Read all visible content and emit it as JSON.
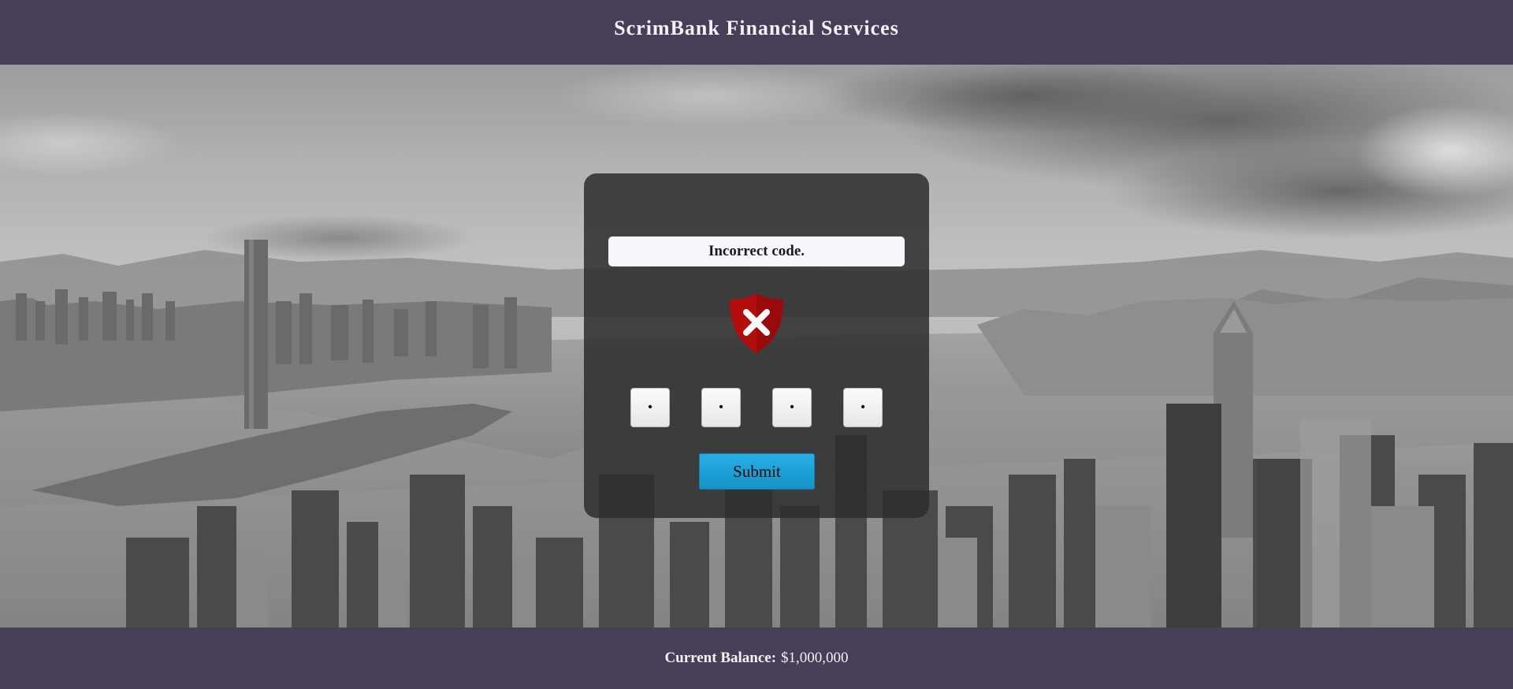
{
  "header": {
    "title": "ScrimBank Financial Services"
  },
  "dialog": {
    "error_message": "Incorrect code.",
    "status_icon": "shield-x-icon",
    "code_digits": [
      "•",
      "•",
      "•",
      "•"
    ],
    "submit_label": "Submit"
  },
  "footer": {
    "balance_label": "Current Balance:",
    "balance_value": "$1,000,000"
  },
  "colors": {
    "bar_background": "#483e58",
    "error_shield": "#b30d0d",
    "submit_button": "#1fa2d9"
  }
}
